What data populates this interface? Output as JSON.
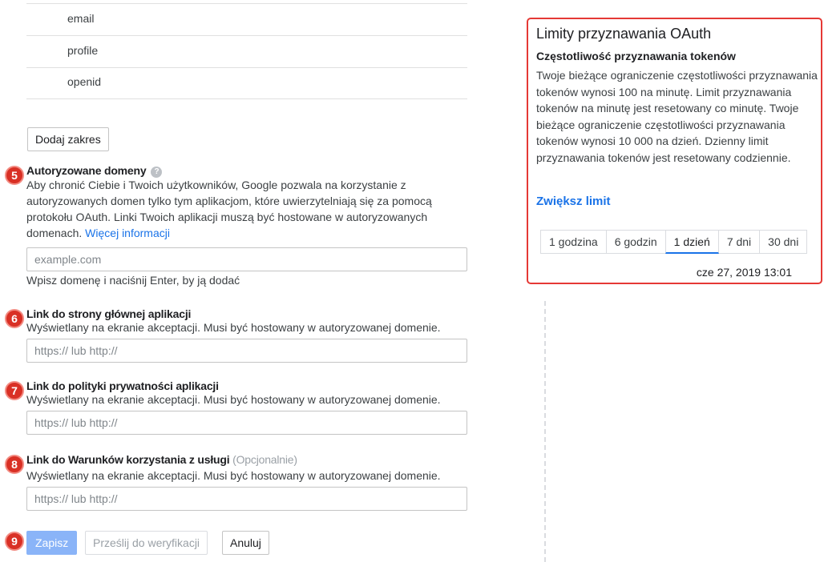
{
  "scopes": [
    "email",
    "profile",
    "openid"
  ],
  "add_scope_label": "Dodaj zakres",
  "badges": [
    "5",
    "6",
    "7",
    "8",
    "9"
  ],
  "domains": {
    "label": "Autoryzowane domeny",
    "help_icon": "?",
    "desc": "Aby chronić Ciebie i Twoich użytkowników, Google pozwala na korzystanie z autoryzowanych domen tylko tym aplikacjom, które uwierzytelniają się za pomocą protokołu OAuth. Linki Twoich aplikacji muszą być hostowane w autoryzowanych domenach. ",
    "more_info": "Więcej informacji",
    "placeholder": "example.com",
    "hint": "Wpisz domenę i naciśnij Enter, by ją dodać"
  },
  "homepage": {
    "label": "Link do strony głównej aplikacji",
    "desc": "Wyświetlany na ekranie akceptacji. Musi być hostowany w autoryzowanej domenie.",
    "placeholder": "https:// lub http://"
  },
  "privacy": {
    "label": "Link do polityki prywatności aplikacji",
    "desc": "Wyświetlany na ekranie akceptacji. Musi być hostowany w autoryzowanej domenie.",
    "placeholder": "https:// lub http://"
  },
  "tos": {
    "label": "Link do Warunków korzystania z usługi",
    "optional": "(Opcjonalnie)",
    "desc": "Wyświetlany na ekranie akceptacji. Musi być hostowany w autoryzowanej domenie.",
    "placeholder": "https:// lub http://"
  },
  "actions": {
    "save": "Zapisz",
    "submit": "Prześlij do weryfikacji",
    "cancel": "Anuluj"
  },
  "quota": {
    "title": "Limity przyznawania OAuth",
    "subtitle": "Częstotliwość przyznawania tokenów",
    "text": "Twoje bieżące ograniczenie częstotliwości przyznawania tokenów wynosi 100 na minutę. Limit przyznawania tokenów na minutę jest resetowany co minutę. Twoje bieżące ograniczenie częstotliwości przyznawania tokenów wynosi 10 000 na dzień. Dzienny limit przyznawania tokenów jest resetowany codziennie.",
    "increase_link": "Zwiększ limit",
    "tabs": [
      "1 godzina",
      "6 godzin",
      "1 dzień",
      "7 dni",
      "30 dni"
    ],
    "active_tab": "1 dzień",
    "date": "cze 27, 2019 13:01"
  },
  "colors": {
    "accent": "#1a73e8",
    "badge": "#d93025",
    "panel_border": "#e53935"
  }
}
